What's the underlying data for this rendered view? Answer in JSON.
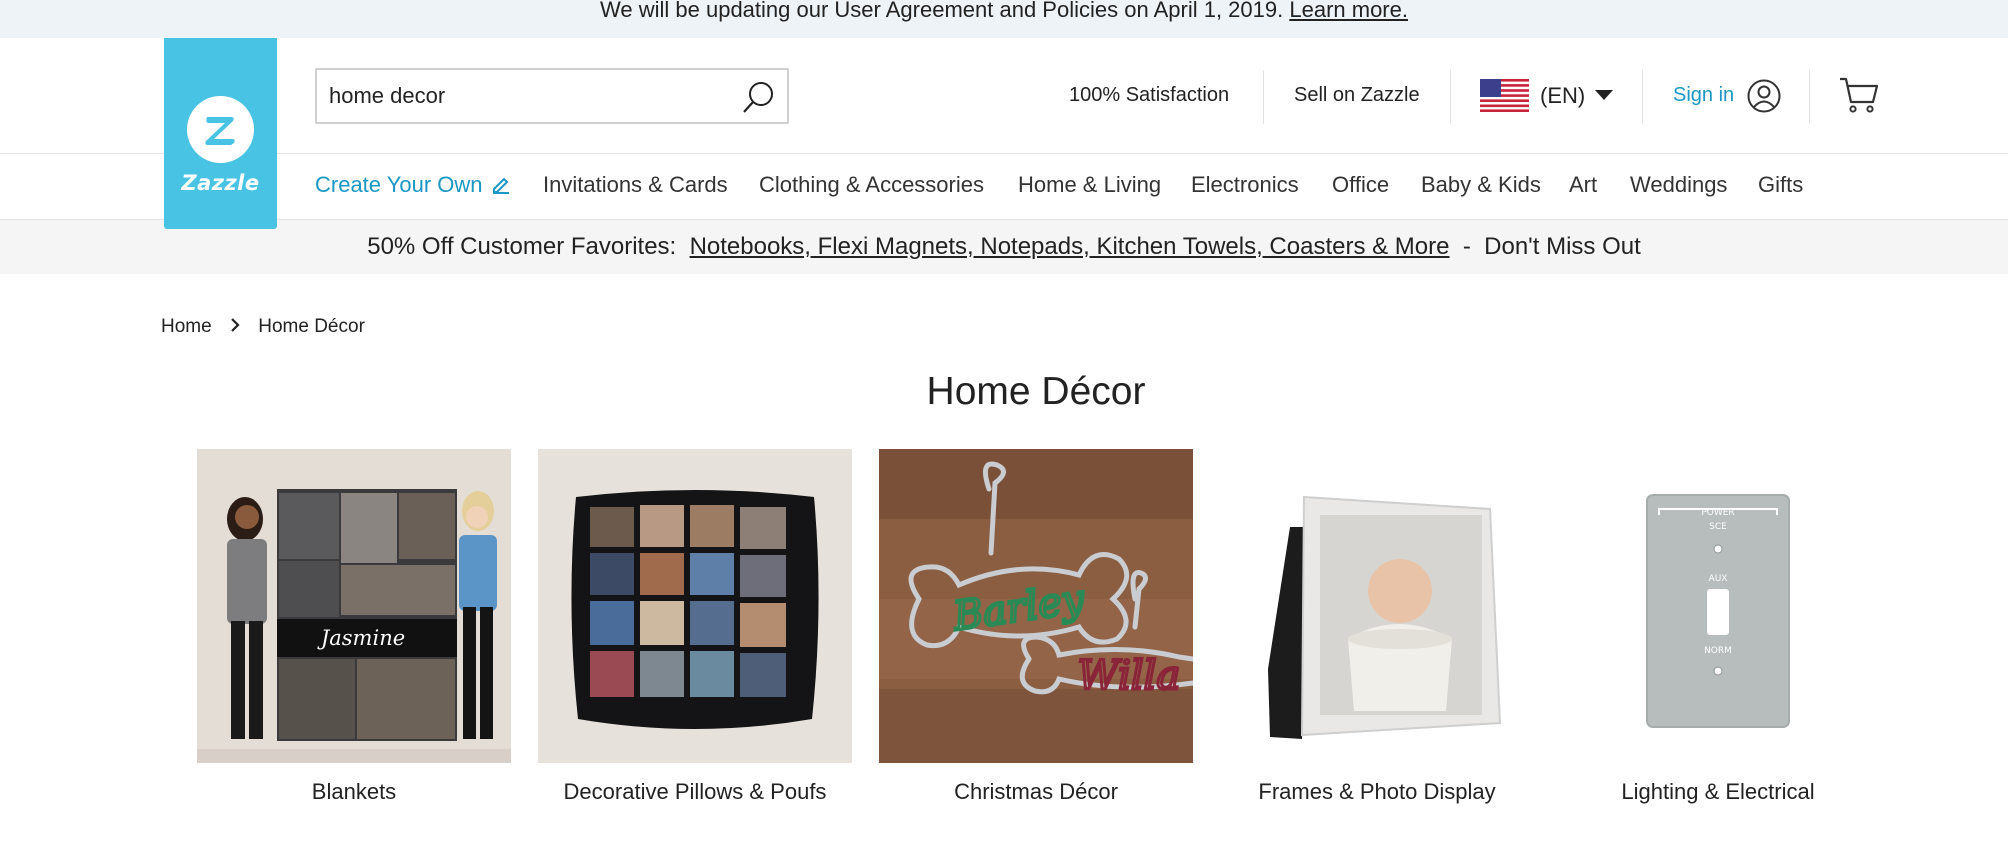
{
  "announcement": {
    "text": "We will be updating our User Agreement and Policies on April 1, 2019.",
    "link": "Learn more."
  },
  "logo": {
    "text": "Zazzle"
  },
  "search": {
    "value": "home decor"
  },
  "header": {
    "satisfaction": "100% Satisfaction",
    "sell": "Sell on Zazzle",
    "language": "(EN)",
    "sign_in": "Sign in"
  },
  "nav": {
    "create": "Create Your Own",
    "items": [
      "Invitations & Cards",
      "Clothing & Accessories",
      "Home & Living",
      "Electronics",
      "Office",
      "Baby & Kids",
      "Art",
      "Weddings",
      "Gifts"
    ]
  },
  "promo": {
    "lead": "50% Off Customer Favorites:",
    "link": "Notebooks, Flexi Magnets, Notepads, Kitchen Towels, Coasters & More",
    "tail": "Don't Miss Out"
  },
  "breadcrumb": [
    "Home",
    "Home Décor"
  ],
  "page_title": "Home Décor",
  "categories": [
    {
      "label": "Blankets",
      "name": "Jasmine"
    },
    {
      "label": "Decorative Pillows & Poufs"
    },
    {
      "label": "Christmas Décor",
      "names": [
        "Barley",
        "Willa"
      ]
    },
    {
      "label": "Frames & Photo Display"
    },
    {
      "label": "Lighting & Electrical",
      "plate_labels": [
        "POWER",
        "SCE",
        "AUX",
        "NORM"
      ]
    }
  ],
  "colors": {
    "brand": "#48c3e4",
    "link": "#1a97c4",
    "announce_bg": "#eef3f8",
    "promo_bg": "#f5f5f5"
  }
}
